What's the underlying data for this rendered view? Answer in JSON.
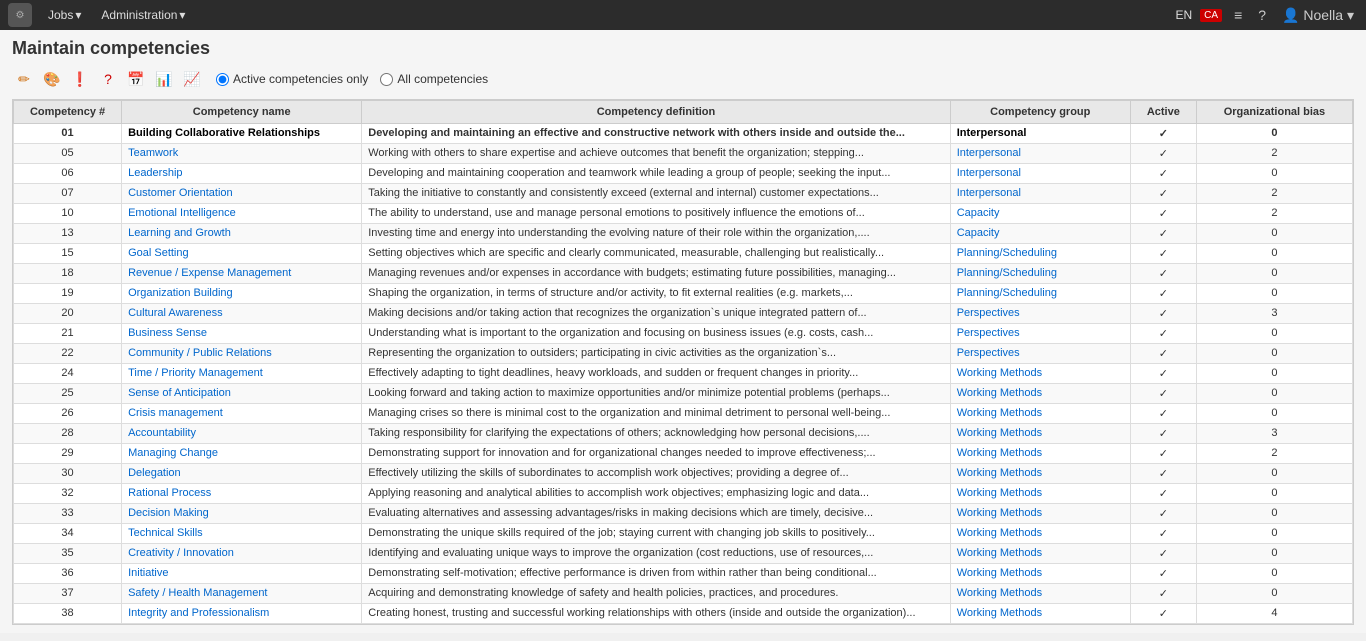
{
  "topNav": {
    "logo": "⚙",
    "items": [
      {
        "label": "Jobs",
        "hasDropdown": true
      },
      {
        "label": "Administration",
        "hasDropdown": true
      }
    ],
    "right": {
      "lang": "EN",
      "flag": "CA",
      "icons": [
        "≡",
        "?",
        "👤"
      ],
      "user": "Noella"
    }
  },
  "pageTitle": "Maintain competencies",
  "toolbar": {
    "icons": [
      "✏",
      "🎨",
      "❗",
      "?",
      "📅",
      "📊",
      "📈"
    ],
    "radioGroup": [
      {
        "label": "Active competencies only",
        "value": "active",
        "checked": true
      },
      {
        "label": "All competencies",
        "value": "all",
        "checked": false
      }
    ]
  },
  "table": {
    "headers": [
      "Competency #",
      "Competency name",
      "Competency definition",
      "Competency group",
      "Active",
      "Organizational bias"
    ],
    "rows": [
      {
        "num": "01",
        "name": "Building Collaborative Relationships",
        "definition": "Developing and maintaining an effective and constructive network with others inside and outside the...",
        "group": "Interpersonal",
        "active": "✓",
        "bias": "0",
        "bold": true
      },
      {
        "num": "05",
        "name": "Teamwork",
        "definition": "Working with others to share expertise and achieve outcomes that benefit the organization; stepping...",
        "group": "Interpersonal",
        "active": "✓",
        "bias": "2"
      },
      {
        "num": "06",
        "name": "Leadership",
        "definition": "Developing and maintaining cooperation and teamwork while leading a group of people; seeking the input...",
        "group": "Interpersonal",
        "active": "✓",
        "bias": "0"
      },
      {
        "num": "07",
        "name": "Customer Orientation",
        "definition": "Taking the initiative to constantly and consistently exceed (external and internal) customer expectations...",
        "group": "Interpersonal",
        "active": "✓",
        "bias": "2"
      },
      {
        "num": "10",
        "name": "Emotional Intelligence",
        "definition": "The ability to understand, use and manage personal emotions to positively influence the emotions of...",
        "group": "Capacity",
        "active": "✓",
        "bias": "2"
      },
      {
        "num": "13",
        "name": "Learning and Growth",
        "definition": "Investing time and energy into understanding the evolving nature of their role within the organization,....",
        "group": "Capacity",
        "active": "✓",
        "bias": "0"
      },
      {
        "num": "15",
        "name": "Goal Setting",
        "definition": "Setting objectives which are specific and clearly communicated, measurable, challenging but realistically...",
        "group": "Planning/Scheduling",
        "active": "✓",
        "bias": "0"
      },
      {
        "num": "18",
        "name": "Revenue / Expense Management",
        "definition": "Managing revenues and/or expenses in accordance with budgets; estimating future possibilities, managing...",
        "group": "Planning/Scheduling",
        "active": "✓",
        "bias": "0"
      },
      {
        "num": "19",
        "name": "Organization Building",
        "definition": "Shaping the organization, in terms of structure and/or activity, to fit external realities (e.g. markets,...",
        "group": "Planning/Scheduling",
        "active": "✓",
        "bias": "0"
      },
      {
        "num": "20",
        "name": "Cultural Awareness",
        "definition": "Making decisions and/or taking action that recognizes the organization`s unique integrated pattern of...",
        "group": "Perspectives",
        "active": "✓",
        "bias": "3"
      },
      {
        "num": "21",
        "name": "Business Sense",
        "definition": "Understanding what is important to the organization and focusing on business issues (e.g. costs, cash...",
        "group": "Perspectives",
        "active": "✓",
        "bias": "0"
      },
      {
        "num": "22",
        "name": "Community / Public Relations",
        "definition": "Representing the organization to outsiders; participating in civic activities as the organization`s...",
        "group": "Perspectives",
        "active": "✓",
        "bias": "0"
      },
      {
        "num": "24",
        "name": "Time / Priority Management",
        "definition": "Effectively adapting to tight deadlines, heavy workloads, and sudden or frequent changes in priority...",
        "group": "Working Methods",
        "active": "✓",
        "bias": "0"
      },
      {
        "num": "25",
        "name": "Sense of Anticipation",
        "definition": "Looking forward and taking action to maximize opportunities and/or minimize potential problems (perhaps...",
        "group": "Working Methods",
        "active": "✓",
        "bias": "0"
      },
      {
        "num": "26",
        "name": "Crisis management",
        "definition": "Managing crises so there is minimal cost to the organization and minimal detriment to personal well-being...",
        "group": "Working Methods",
        "active": "✓",
        "bias": "0"
      },
      {
        "num": "28",
        "name": "Accountability",
        "definition": "Taking responsibility for clarifying the expectations of others; acknowledging how personal decisions,....",
        "group": "Working Methods",
        "active": "✓",
        "bias": "3"
      },
      {
        "num": "29",
        "name": "Managing Change",
        "definition": "Demonstrating support for innovation and for organizational changes needed to improve effectiveness;...",
        "group": "Working Methods",
        "active": "✓",
        "bias": "2"
      },
      {
        "num": "30",
        "name": "Delegation",
        "definition": "Effectively utilizing the skills of subordinates to accomplish work objectives; providing a degree of...",
        "group": "Working Methods",
        "active": "✓",
        "bias": "0"
      },
      {
        "num": "32",
        "name": "Rational Process",
        "definition": "Applying reasoning and analytical abilities to accomplish work objectives; emphasizing logic and data...",
        "group": "Working Methods",
        "active": "✓",
        "bias": "0"
      },
      {
        "num": "33",
        "name": "Decision Making",
        "definition": "Evaluating alternatives and assessing advantages/risks in making decisions which are timely, decisive...",
        "group": "Working Methods",
        "active": "✓",
        "bias": "0"
      },
      {
        "num": "34",
        "name": "Technical Skills",
        "definition": "Demonstrating the unique skills required of the job; staying current with changing job skills to positively...",
        "group": "Working Methods",
        "active": "✓",
        "bias": "0"
      },
      {
        "num": "35",
        "name": "Creativity / Innovation",
        "definition": "Identifying and evaluating unique ways to improve the organization (cost reductions, use of resources,...",
        "group": "Working Methods",
        "active": "✓",
        "bias": "0"
      },
      {
        "num": "36",
        "name": "Initiative",
        "definition": "Demonstrating self-motivation; effective performance is driven from within rather than being conditional...",
        "group": "Working Methods",
        "active": "✓",
        "bias": "0"
      },
      {
        "num": "37",
        "name": "Safety / Health Management",
        "definition": "Acquiring and demonstrating knowledge of safety and health policies, practices, and procedures.",
        "group": "Working Methods",
        "active": "✓",
        "bias": "0"
      },
      {
        "num": "38",
        "name": "Integrity and Professionalism",
        "definition": "Creating honest, trusting and successful working relationships with others (inside and outside the organization)...",
        "group": "Working Methods",
        "active": "✓",
        "bias": "4"
      }
    ]
  }
}
